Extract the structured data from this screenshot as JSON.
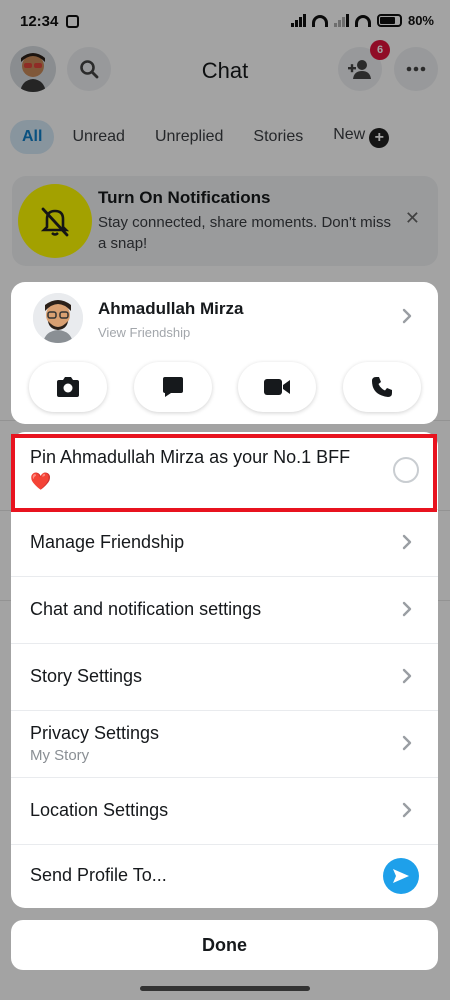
{
  "status_bar": {
    "time": "12:34",
    "battery": "80%"
  },
  "header": {
    "title": "Chat",
    "friend_requests_count": "6"
  },
  "tabs": [
    {
      "label": "All",
      "active": true
    },
    {
      "label": "Unread",
      "active": false
    },
    {
      "label": "Unreplied",
      "active": false
    },
    {
      "label": "Stories",
      "active": false
    },
    {
      "label": "New",
      "active": false
    }
  ],
  "notification_card": {
    "title": "Turn On Notifications",
    "body": "Stay connected, share moments. Don't miss a snap!"
  },
  "friend": {
    "name": "Ahmadullah Mirza",
    "subtitle": "View Friendship"
  },
  "actions": [
    {
      "icon": "camera-icon"
    },
    {
      "icon": "chat-icon"
    },
    {
      "icon": "video-call-icon"
    },
    {
      "icon": "phone-icon"
    }
  ],
  "menu": {
    "pin_label": "Pin Ahmadullah Mirza as your No.1 BFF",
    "pin_emoji": "❤️",
    "items": [
      {
        "label": "Manage Friendship"
      },
      {
        "label": "Chat and notification settings"
      },
      {
        "label": "Story Settings"
      },
      {
        "label": "Privacy Settings",
        "sub": "My Story"
      },
      {
        "label": "Location Settings"
      },
      {
        "label": "Send Profile To..."
      }
    ]
  },
  "done_label": "Done",
  "colors": {
    "accent_yellow": "#fffc00",
    "highlight_red": "#e8131f",
    "send_blue": "#1ea0ea",
    "badge_red": "#e1143c"
  }
}
